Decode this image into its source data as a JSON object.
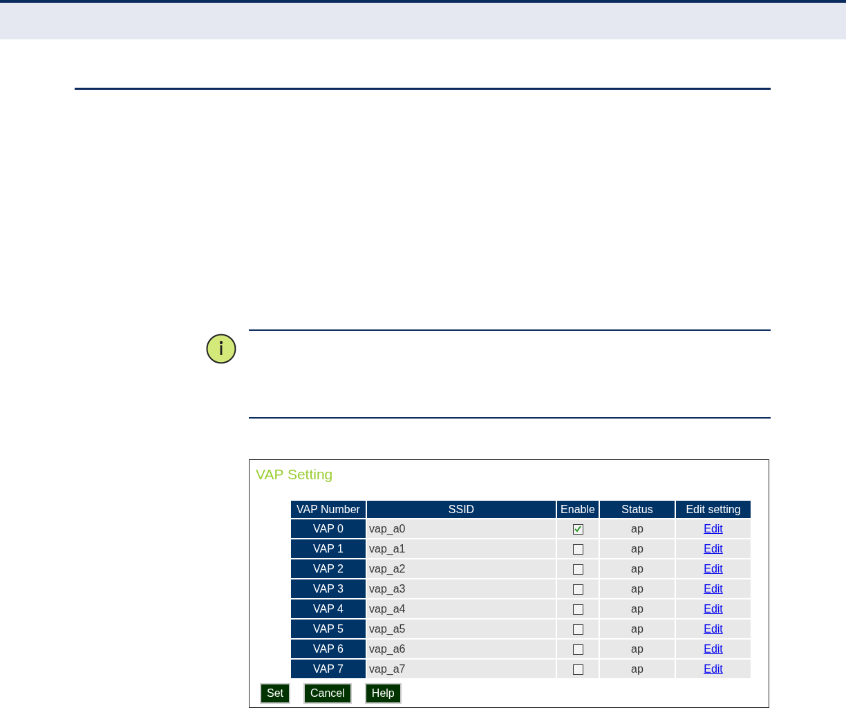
{
  "panel": {
    "title": "VAP Setting"
  },
  "table": {
    "columns": [
      "VAP Number",
      "SSID",
      "Enable",
      "Status",
      "Edit setting"
    ],
    "rows": [
      {
        "number": "VAP 0",
        "ssid": "vap_a0",
        "checked": true,
        "status": "ap",
        "action": "Edit"
      },
      {
        "number": "VAP 1",
        "ssid": "vap_a1",
        "checked": false,
        "status": "ap",
        "action": "Edit"
      },
      {
        "number": "VAP 2",
        "ssid": "vap_a2",
        "checked": false,
        "status": "ap",
        "action": "Edit"
      },
      {
        "number": "VAP 3",
        "ssid": "vap_a3",
        "checked": false,
        "status": "ap",
        "action": "Edit"
      },
      {
        "number": "VAP 4",
        "ssid": "vap_a4",
        "checked": false,
        "status": "ap",
        "action": "Edit"
      },
      {
        "number": "VAP 5",
        "ssid": "vap_a5",
        "checked": false,
        "status": "ap",
        "action": "Edit"
      },
      {
        "number": "VAP 6",
        "ssid": "vap_a6",
        "checked": false,
        "status": "ap",
        "action": "Edit"
      },
      {
        "number": "VAP 7",
        "ssid": "vap_a7",
        "checked": false,
        "status": "ap",
        "action": "Edit"
      }
    ]
  },
  "buttons": [
    "Set",
    "Cancel",
    "Help"
  ]
}
